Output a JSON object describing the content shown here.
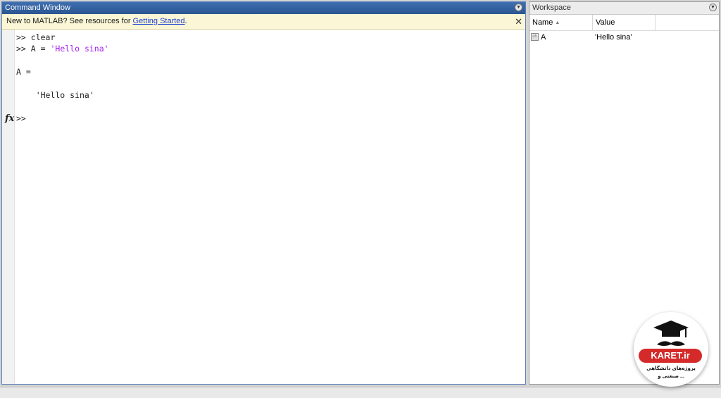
{
  "command_window": {
    "title": "Command Window",
    "notice": {
      "text": "New to MATLAB? See resources for ",
      "link": "Getting Started",
      "suffix": ".",
      "close": "✕"
    },
    "lines": [
      {
        "prompt": ">> ",
        "text": "clear"
      },
      {
        "prompt": ">> ",
        "text": "A = ",
        "string": "'Hello sina'"
      },
      {
        "text": "A ="
      },
      {
        "text": "    'Hello sina'"
      }
    ],
    "fx_label": "fx",
    "prompt": ">>"
  },
  "workspace": {
    "title": "Workspace",
    "columns": [
      "Name",
      "Value"
    ],
    "sort_indicator": "▲",
    "rows": [
      {
        "name": "A",
        "value": "'Hello sina'",
        "icon": "char-array-icon"
      }
    ]
  },
  "logo": {
    "brand": "KARET.ir",
    "line1": "پروژه‌های دانشگاهی",
    "line2": "صنعتی و ..."
  }
}
